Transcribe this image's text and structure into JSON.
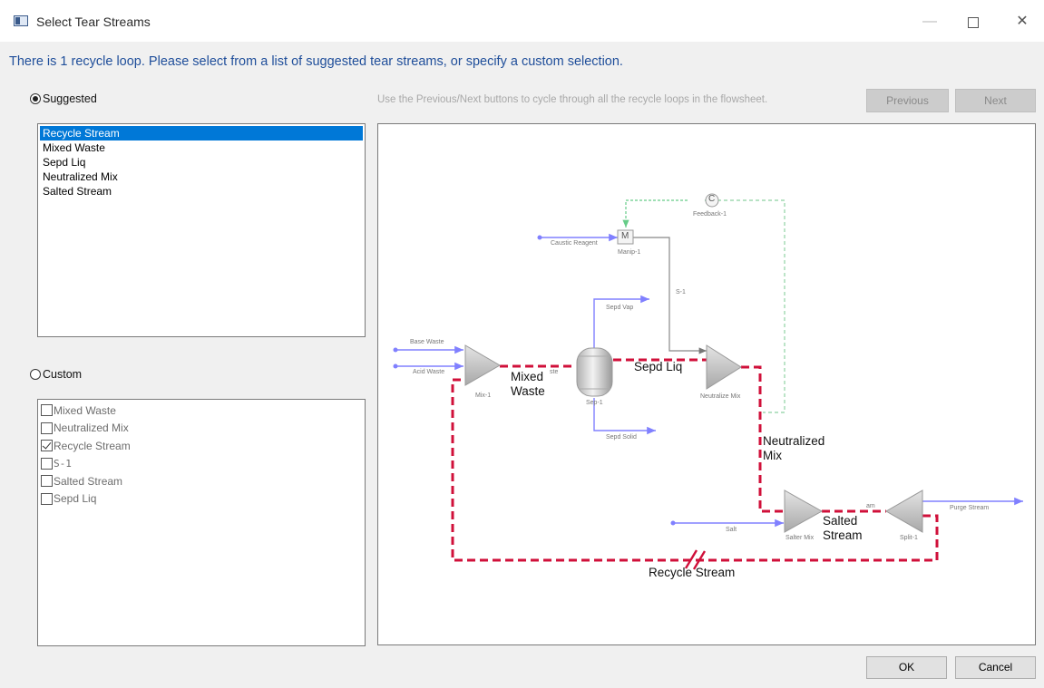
{
  "window": {
    "title": "Select Tear Streams",
    "minimize_glyph": "—",
    "close_glyph": "✕"
  },
  "instruction": "There is 1 recycle loop. Please select from a list of suggested tear streams, or specify a custom selection.",
  "suggested": {
    "label": "Suggested",
    "selected": true,
    "items": [
      "Recycle Stream",
      "Mixed Waste",
      "Sepd Liq",
      "Neutralized Mix",
      "Salted Stream"
    ],
    "selected_index": 0
  },
  "custom": {
    "label": "Custom",
    "selected": false,
    "items": [
      {
        "label": "Mixed Waste",
        "checked": false
      },
      {
        "label": "Neutralized Mix",
        "checked": false
      },
      {
        "label": "Recycle Stream",
        "checked": true
      },
      {
        "label": "S-1",
        "checked": false
      },
      {
        "label": "Salted Stream",
        "checked": false
      },
      {
        "label": "Sepd Liq",
        "checked": false
      }
    ]
  },
  "navigation": {
    "hint": "Use the Previous/Next buttons to cycle through all the recycle loops in the flowsheet.",
    "previous_label": "Previous",
    "next_label": "Next"
  },
  "flowsheet": {
    "unit_symbols": {
      "manip": "M",
      "feedback": "C"
    },
    "units": {
      "manip": "Manip-1",
      "feedback": "Feedback-1",
      "mix": "Mix-1",
      "sep": "Sep-1",
      "neutralize": "Neutralize Mix",
      "salter": "Salter Mix",
      "split": "Split-1"
    },
    "streams": {
      "caustic": "Caustic Reagent",
      "s1": "S-1",
      "sepd_vap": "Sepd Vap",
      "base_waste": "Base Waste",
      "acid_waste": "Acid Waste",
      "sepd_solid": "Sepd Solid",
      "salt": "Salt",
      "purge": "Purge Stream"
    },
    "fragments": {
      "ste": "ste",
      "am": "am"
    },
    "highlighted_labels": {
      "mixed_waste": "Mixed\nWaste",
      "sepd_liq": "Sepd Liq",
      "neutralized_mix": "Neutralized\nMix",
      "salted_stream": "Salted\nStream",
      "recycle_stream": "Recycle Stream"
    },
    "colors": {
      "stream": "#8080ff",
      "highlight": "#d0103a",
      "control": "#9fd9b0",
      "unit": "#c8c8c8"
    }
  },
  "buttons": {
    "ok": "OK",
    "cancel": "Cancel"
  }
}
